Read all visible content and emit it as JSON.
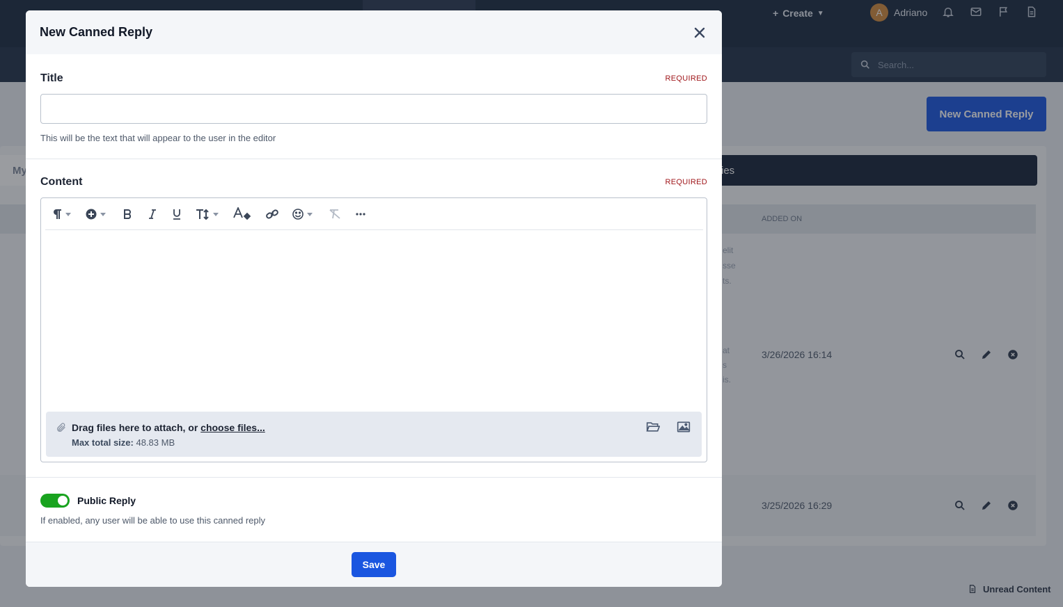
{
  "background": {
    "topbar": {
      "create_label": "Create",
      "user_name": "Adriano",
      "user_initial": "A"
    },
    "search_placeholder": "Search...",
    "new_canned_reply_button": "New Canned Reply",
    "tab_my_fragment": "My",
    "tab_right_fragment": "ies",
    "table": {
      "col_added_on": "ADDED ON",
      "rows": [
        {
          "added_on": "3/26/2026 16:14"
        },
        {
          "added_on": "3/25/2026 16:29"
        }
      ]
    },
    "row_text_fragments": [
      "elit",
      "sse",
      "ts.",
      "at",
      "s",
      "is."
    ],
    "unread_content": "Unread Content"
  },
  "modal": {
    "title": "New Canned Reply",
    "title_field": {
      "label": "Title",
      "required": "REQUIRED",
      "value": "",
      "hint": "This will be the text that will appear to the user in the editor"
    },
    "content_field": {
      "label": "Content",
      "required": "REQUIRED",
      "toolbar": [
        "paragraph-format-icon",
        "insert-icon",
        "bold-icon",
        "italic-icon",
        "underline-icon",
        "font-size-icon",
        "text-color-icon",
        "link-icon",
        "emoji-icon",
        "clear-formatting-icon",
        "more-icon"
      ],
      "attach": {
        "drag_text": "Drag files here to attach, or ",
        "choose_link": "choose files...",
        "max_label": "Max total size:",
        "max_value": " 48.83 MB"
      }
    },
    "public_reply": {
      "label": "Public Reply",
      "enabled": true,
      "hint": "If enabled, any user will be able to use this canned reply"
    },
    "save_label": "Save"
  }
}
